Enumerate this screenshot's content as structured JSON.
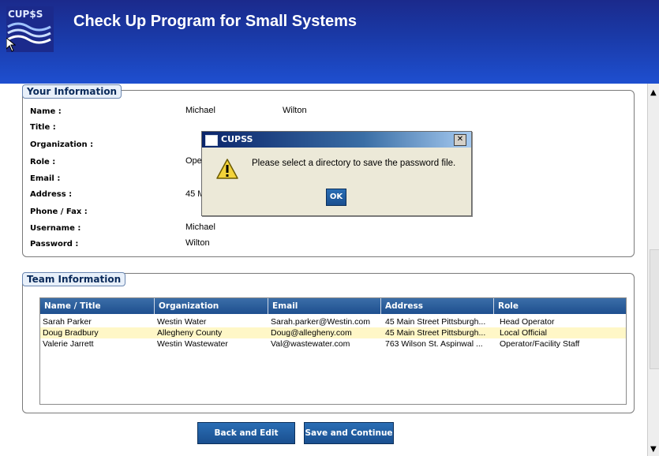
{
  "app": {
    "logo_text": "CUP$S",
    "title": "Check Up Program for Small Systems"
  },
  "your_info": {
    "tab_label": "Your Information",
    "labels": {
      "name": "Name :",
      "title": "Title :",
      "organization": "Organization :",
      "role": "Role :",
      "email": "Email :",
      "address": "Address :",
      "phone_fax": "Phone / Fax :",
      "username": "Username :",
      "password": "Password :"
    },
    "values": {
      "first_name": "Michael",
      "last_name": "Wilton",
      "role": "Ope",
      "address": "45 M",
      "username": "Michael",
      "password": "Wilton"
    }
  },
  "team_info": {
    "tab_label": "Team Information",
    "columns": [
      "Name / Title",
      "Organization",
      "Email",
      "Address",
      "Role"
    ],
    "rows": [
      [
        "Sarah Parker",
        "Westin Water",
        "Sarah.parker@Westin.com",
        "45 Main Street Pittsburgh...",
        "Head Operator"
      ],
      [
        "Doug  Bradbury",
        "Allegheny County",
        "Doug@allegheny.com",
        "45 Main Street Pittsburgh...",
        "Local Official"
      ],
      [
        "Valerie Jarrett",
        "Westin Wastewater",
        "Val@wastewater.com",
        "763 Wilson St.  Aspinwal ...",
        "Operator/Facility Staff"
      ]
    ]
  },
  "buttons": {
    "back": "Back and Edit",
    "save": "Save and Continue"
  },
  "dialog": {
    "title": "CUPSS",
    "close_label": "✕",
    "message": "Please select a directory to save the password file.",
    "ok_label": "OK"
  },
  "colors": {
    "header_bg": "#1a3aa8",
    "button_bg": "#1a4f8f",
    "highlight_row": "#fff7c7"
  }
}
